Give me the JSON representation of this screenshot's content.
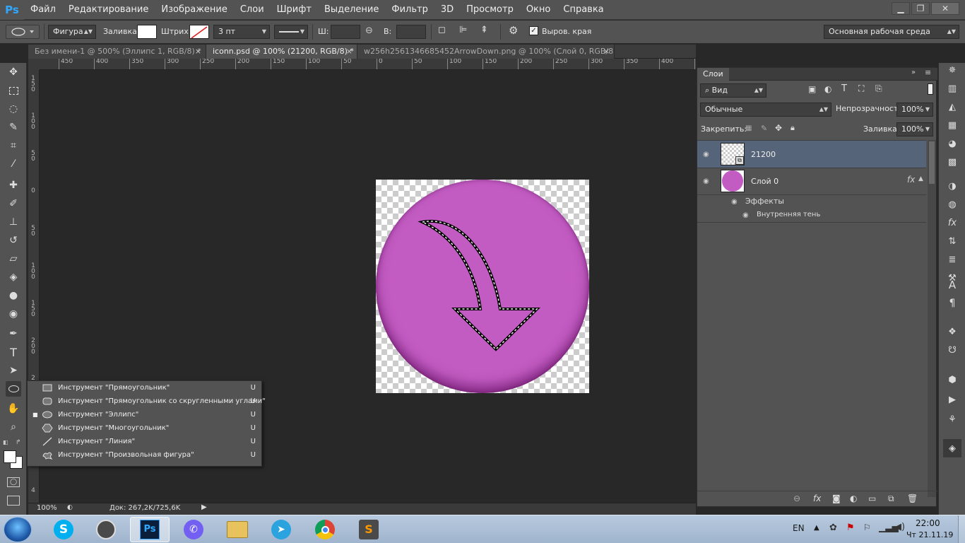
{
  "menubar": {
    "logo": "Ps",
    "items": [
      "Файл",
      "Редактирование",
      "Изображение",
      "Слои",
      "Шрифт",
      "Выделение",
      "Фильтр",
      "3D",
      "Просмотр",
      "Окно",
      "Справка"
    ],
    "win_min": "▁",
    "win_restore": "❐",
    "win_close": "✕"
  },
  "options": {
    "mode": "Фигура",
    "fill_label": "Заливка:",
    "stroke_label": "Штрих:",
    "stroke_width": "3 пт",
    "w_label": "Ш:",
    "h_label": "В:",
    "antialias_label": "Выров. края",
    "workspace": "Основная рабочая среда"
  },
  "tabs": [
    {
      "label": "Без имени-1 @ 500% (Эллипс 1, RGB/8) *",
      "close": "×"
    },
    {
      "label": "iconn.psd @ 100% (21200, RGB/8) *",
      "close": "×"
    },
    {
      "label": "w256h2561346685452ArrowDown.png @ 100% (Слой 0, RGB/8)",
      "close": "×"
    }
  ],
  "ruler_top": [
    "450",
    "400",
    "350",
    "300",
    "250",
    "200",
    "150",
    "100",
    "50",
    "0",
    "50",
    "100",
    "150",
    "200",
    "250",
    "300",
    "350",
    "400",
    "450"
  ],
  "ruler_left": [
    "1 5 0",
    "1 0 0",
    "5 0",
    "0",
    "5 0",
    "1 0 0",
    "1 5 0",
    "2 0 0",
    "2 5 0",
    "3 0 0",
    "3 5 0",
    "4"
  ],
  "flyout": {
    "items": [
      {
        "label": "Инструмент \"Прямоугольник\"",
        "key": "U",
        "icon": "rectangle-icon"
      },
      {
        "label": "Инструмент \"Прямоугольник со скругленными углами\"",
        "key": "U",
        "icon": "rounded-rectangle-icon"
      },
      {
        "label": "Инструмент \"Эллипс\"",
        "key": "U",
        "icon": "ellipse-icon",
        "selected": true
      },
      {
        "label": "Инструмент \"Многоугольник\"",
        "key": "U",
        "icon": "polygon-icon"
      },
      {
        "label": "Инструмент \"Линия\"",
        "key": "U",
        "icon": "line-icon"
      },
      {
        "label": "Инструмент \"Произвольная фигура\"",
        "key": "U",
        "icon": "custom-shape-icon"
      }
    ],
    "bullet": "■"
  },
  "status": {
    "zoom": "100%",
    "doc": "Док: 267,2K/725,6K"
  },
  "layers_panel": {
    "tab": "Слои",
    "filter": "Вид",
    "blend_mode": "Обычные",
    "opacity_label": "Непрозрачность:",
    "opacity": "100%",
    "lock_label": "Закрепить:",
    "fill_label": "Заливка:",
    "fill": "100%",
    "layers": [
      {
        "name": "21200",
        "selected": true
      },
      {
        "name": "Слой 0",
        "fx": "fx",
        "effects_label": "Эффекты",
        "effect": "Внутренняя тень"
      }
    ]
  },
  "canvas": {
    "circle_color": "#c25bc2",
    "accent": "#31a8ff"
  },
  "taskbar": {
    "lang": "EN",
    "time": "22:00",
    "date": "Чт 21.11.19",
    "apps": [
      "start-button",
      "skype-icon",
      "app-icon",
      "photoshop-icon",
      "viber-icon",
      "file-explorer-icon",
      "telegram-icon",
      "chrome-icon",
      "sublime-icon"
    ]
  }
}
